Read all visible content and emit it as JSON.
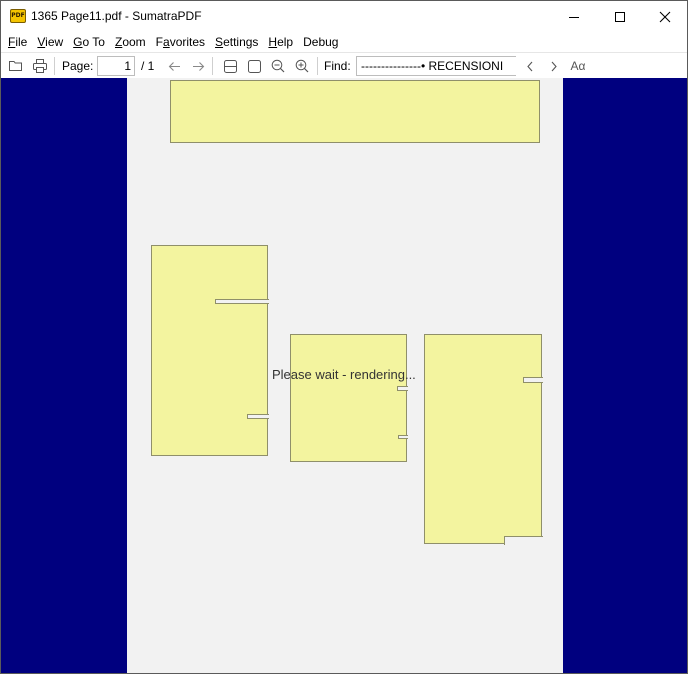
{
  "window": {
    "title": "1365 Page11.pdf - SumatraPDF",
    "app_icon_text": "PDF"
  },
  "menu": {
    "items": [
      {
        "label": "File",
        "mnemonic": "F",
        "rest": "ile"
      },
      {
        "label": "View",
        "mnemonic": "V",
        "rest": "iew"
      },
      {
        "label": "Go To",
        "mnemonic": "G",
        "rest": "o To"
      },
      {
        "label": "Zoom",
        "mnemonic": "Z",
        "rest": "oom"
      },
      {
        "label": "Favorites",
        "pre": "F",
        "mnemonic": "a",
        "rest": "vorites"
      },
      {
        "label": "Settings",
        "mnemonic": "S",
        "rest": "ettings"
      },
      {
        "label": "Help",
        "mnemonic": "H",
        "rest": "elp"
      },
      {
        "label": "Debug",
        "mnemonic": "",
        "rest": "Debug"
      }
    ]
  },
  "toolbar": {
    "page_label": "Page:",
    "page_value": "1",
    "page_total": "/ 1",
    "find_label": "Find:",
    "find_value": "---------------• RECENSIONI",
    "match_case_glyph": "Aα"
  },
  "document": {
    "status_text": "Please wait - rendering...",
    "colors": {
      "canvas_bg": "#00007f",
      "page_bg": "#f2f2f2",
      "block_fill": "#f3f49f"
    }
  }
}
